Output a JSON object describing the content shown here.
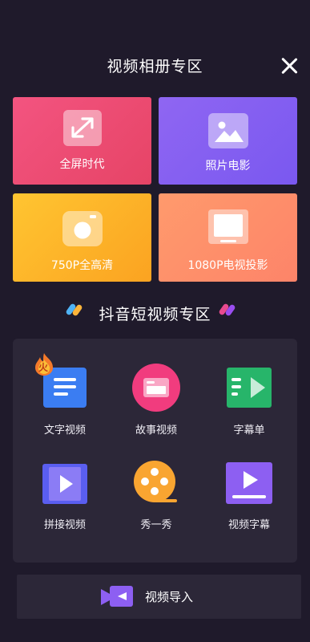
{
  "header": {
    "title": "视频相册专区"
  },
  "cards": [
    {
      "label": "全屏时代",
      "icon": "expand-arrows-icon",
      "color": "#f04d73"
    },
    {
      "label": "照片电影",
      "icon": "image-icon",
      "color": "#8560f1"
    },
    {
      "label": "750P全高清",
      "icon": "camera-icon",
      "color": "#fdb42a"
    },
    {
      "label": "1080P电视投影",
      "icon": "tv-icon",
      "color": "#fe8f6a"
    }
  ],
  "section": {
    "title": "抖音短视频专区"
  },
  "grid": [
    {
      "label": "文字视频",
      "icon": "text-video-icon",
      "badge": "火"
    },
    {
      "label": "故事视频",
      "icon": "story-video-icon"
    },
    {
      "label": "字幕单",
      "icon": "subtitle-list-icon"
    },
    {
      "label": "拼接视频",
      "icon": "splice-video-icon"
    },
    {
      "label": "秀一秀",
      "icon": "film-reel-icon"
    },
    {
      "label": "视频字幕",
      "icon": "video-subtitle-icon"
    }
  ],
  "import": {
    "label": "视频导入",
    "icon": "video-import-icon"
  }
}
